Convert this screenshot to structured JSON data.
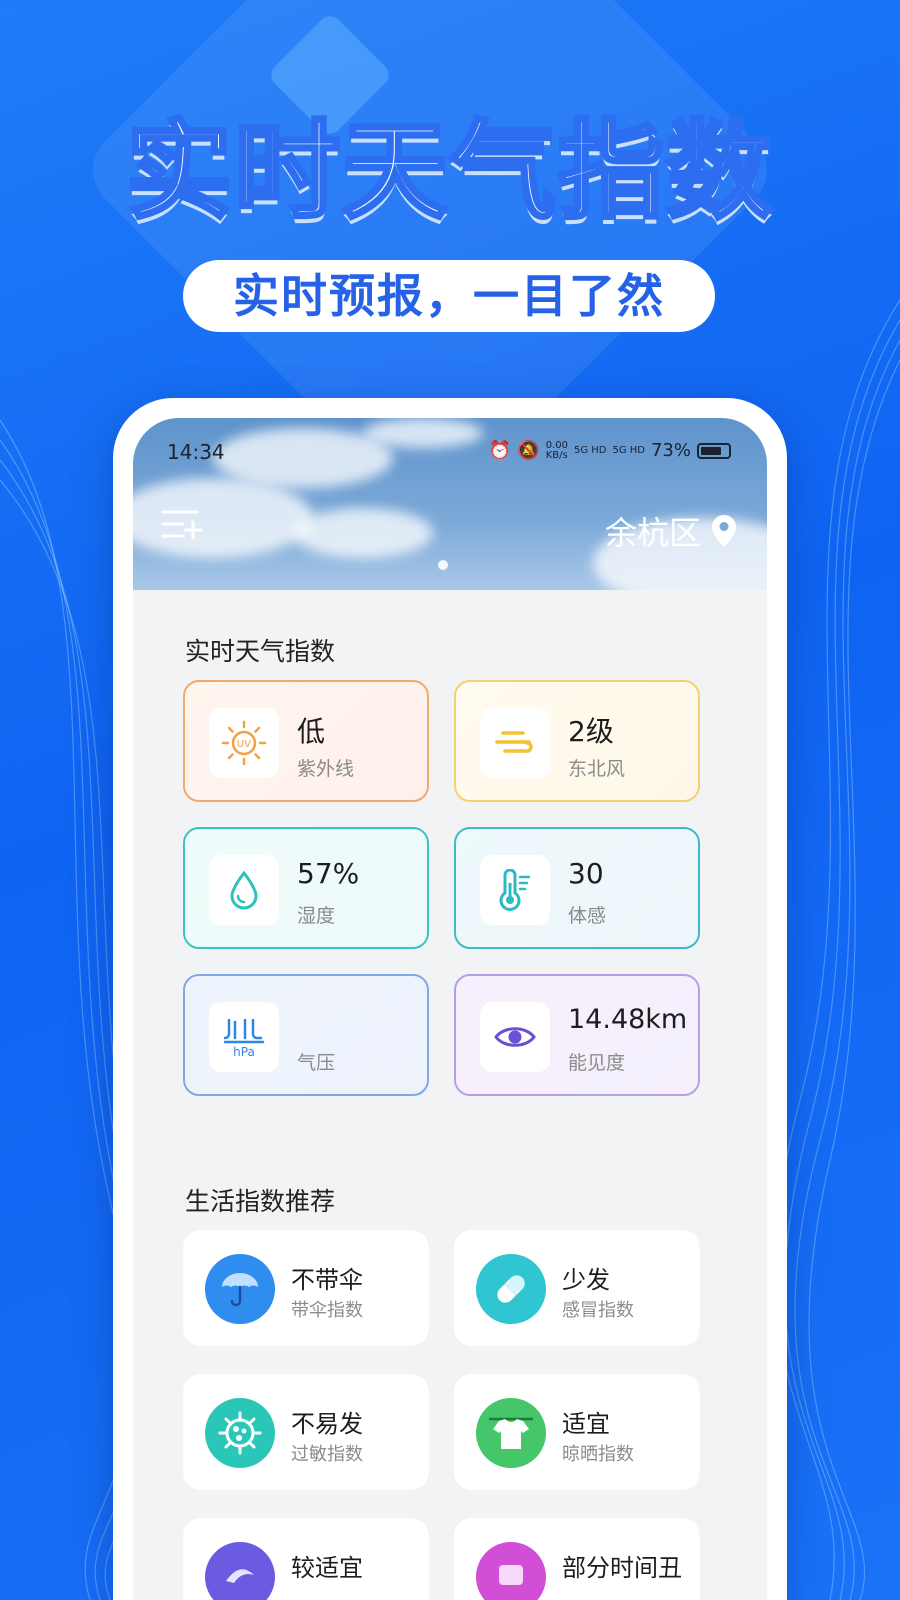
{
  "promo": {
    "headline": "实时天气指数",
    "subtitle": "实时预报，一目了然"
  },
  "status_bar": {
    "time": "14:34",
    "net_speed": "0.00",
    "net_unit": "KB/s",
    "sim1": "5G HD",
    "sim2": "5G HD",
    "battery": "73%"
  },
  "header": {
    "city": "余杭区",
    "menu_icon": "menu-add-icon",
    "location_icon": "location-pin-icon"
  },
  "weather_section": {
    "title": "实时天气指数",
    "cards": [
      {
        "value": "低",
        "label": "紫外线",
        "icon": "uv-sun-icon",
        "color": "#f0a464"
      },
      {
        "value": "2级",
        "label": "东北风",
        "icon": "wind-icon",
        "color": "#f3cf6b"
      },
      {
        "value": "57%",
        "label": "湿度",
        "icon": "water-drop-icon",
        "color": "#37c8c0"
      },
      {
        "value": "30",
        "label": "体感",
        "icon": "thermometer-icon",
        "color": "#3bbcc7"
      },
      {
        "value": "",
        "label": "气压",
        "icon": "pressure-hpa-icon",
        "color": "#79a7e8"
      },
      {
        "value": "14.48km",
        "label": "能见度",
        "icon": "eye-icon",
        "color": "#b49be6"
      }
    ]
  },
  "life_section": {
    "title": "生活指数推荐",
    "items": [
      {
        "value": "不带伞",
        "label": "带伞指数",
        "icon": "umbrella-icon",
        "color": "#2f8df0"
      },
      {
        "value": "少发",
        "label": "感冒指数",
        "icon": "pill-icon",
        "color": "#2fc6d2"
      },
      {
        "value": "不易发",
        "label": "过敏指数",
        "icon": "allergen-icon",
        "color": "#2ac7b8"
      },
      {
        "value": "适宜",
        "label": "晾晒指数",
        "icon": "laundry-icon",
        "color": "#45c66a"
      },
      {
        "value": "较适宜",
        "label": "",
        "icon": "sport-icon",
        "color": "#6a5be0"
      },
      {
        "value": "部分时间丑",
        "label": "",
        "icon": "sky-icon",
        "color": "#d04fd6"
      }
    ]
  }
}
